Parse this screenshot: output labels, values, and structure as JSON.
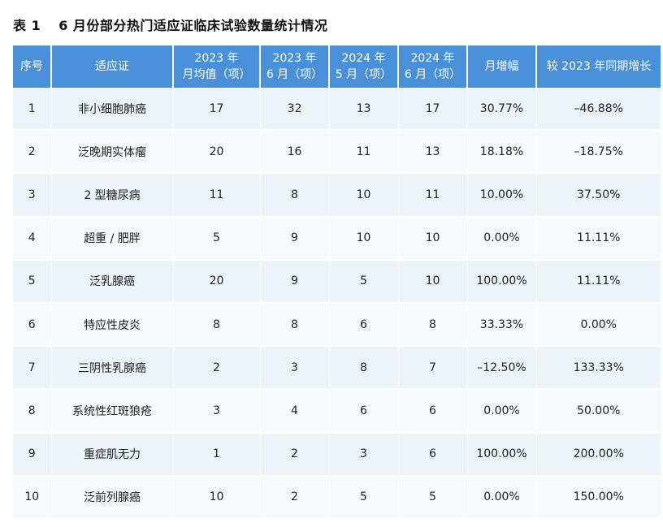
{
  "caption": {
    "number": "表 1",
    "title": "6 月份部分热门适应证临床试验数量统计情况"
  },
  "colors": {
    "header_bg": "#4a90d9",
    "row_odd": "#eef3f9",
    "row_even": "#f7f9fc"
  },
  "table": {
    "headers": [
      [
        "序号"
      ],
      [
        "适应证"
      ],
      [
        "2023 年",
        "月均值（项）"
      ],
      [
        "2023 年",
        "6 月（项）"
      ],
      [
        "2024 年",
        "5 月（项）"
      ],
      [
        "2024 年",
        "6 月（项）"
      ],
      [
        "月增幅"
      ],
      [
        "较 2023 年同期增长"
      ]
    ],
    "rows": [
      [
        "1",
        "非小细胞肺癌",
        "17",
        "32",
        "13",
        "17",
        "30.77%",
        "–46.88%"
      ],
      [
        "2",
        "泛晚期实体瘤",
        "20",
        "16",
        "11",
        "13",
        "18.18%",
        "–18.75%"
      ],
      [
        "3",
        "2 型糖尿病",
        "11",
        "8",
        "10",
        "11",
        "10.00%",
        "37.50%"
      ],
      [
        "4",
        "超重 / 肥胖",
        "5",
        "9",
        "10",
        "10",
        "0.00%",
        "11.11%"
      ],
      [
        "5",
        "泛乳腺癌",
        "20",
        "9",
        "5",
        "10",
        "100.00%",
        "11.11%"
      ],
      [
        "6",
        "特应性皮炎",
        "8",
        "8",
        "6",
        "8",
        "33.33%",
        "0.00%"
      ],
      [
        "7",
        "三阴性乳腺癌",
        "2",
        "3",
        "8",
        "7",
        "–12.50%",
        "133.33%"
      ],
      [
        "8",
        "系统性红斑狼疮",
        "3",
        "4",
        "6",
        "6",
        "0.00%",
        "50.00%"
      ],
      [
        "9",
        "重症肌无力",
        "1",
        "2",
        "3",
        "6",
        "100.00%",
        "200.00%"
      ],
      [
        "10",
        "泛前列腺癌",
        "10",
        "2",
        "5",
        "5",
        "0.00%",
        "150.00%"
      ]
    ]
  }
}
